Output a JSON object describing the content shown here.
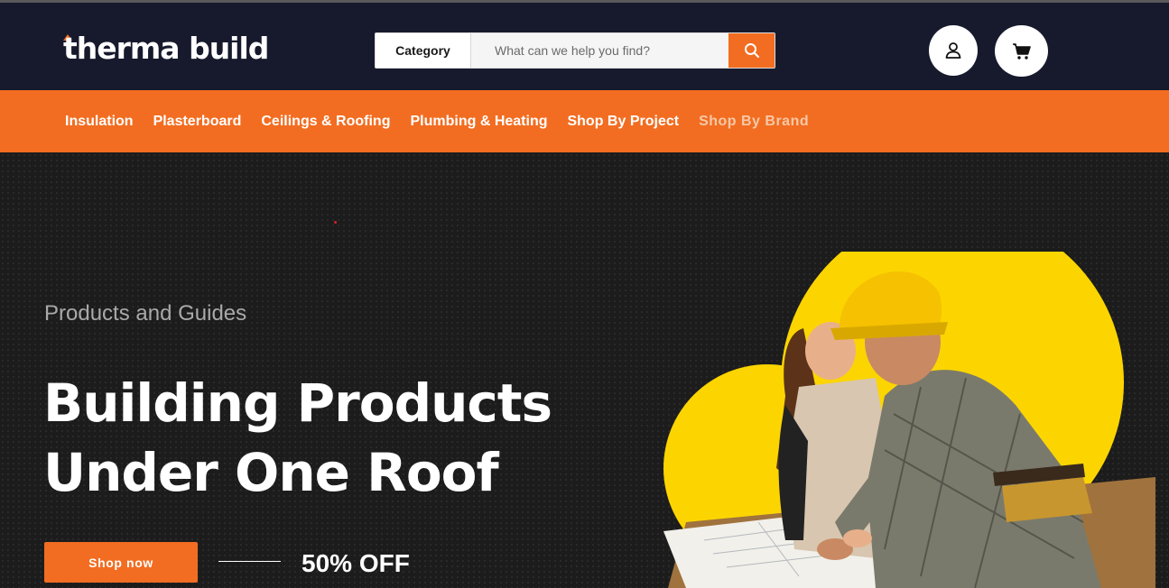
{
  "header": {
    "logo_text": "therma build",
    "search": {
      "category_label": "Category",
      "placeholder": "What can we help you find?"
    }
  },
  "nav": {
    "items": [
      {
        "label": "Insulation"
      },
      {
        "label": "Plasterboard"
      },
      {
        "label": "Ceilings & Roofing"
      },
      {
        "label": "Plumbing & Heating"
      },
      {
        "label": "Shop By Project"
      },
      {
        "label": "Shop By Brand"
      }
    ]
  },
  "hero": {
    "eyebrow": "Products and Guides",
    "headline_line1": "Building Products",
    "headline_line2": "Under One Roof",
    "cta_label": "Shop now",
    "offer_text": "50% OFF"
  },
  "colors": {
    "brand_orange": "#f26d21",
    "header_navy": "#171a2d",
    "accent_yellow": "#fcd500"
  },
  "icons": [
    "search-icon",
    "user-icon",
    "cart-icon"
  ]
}
